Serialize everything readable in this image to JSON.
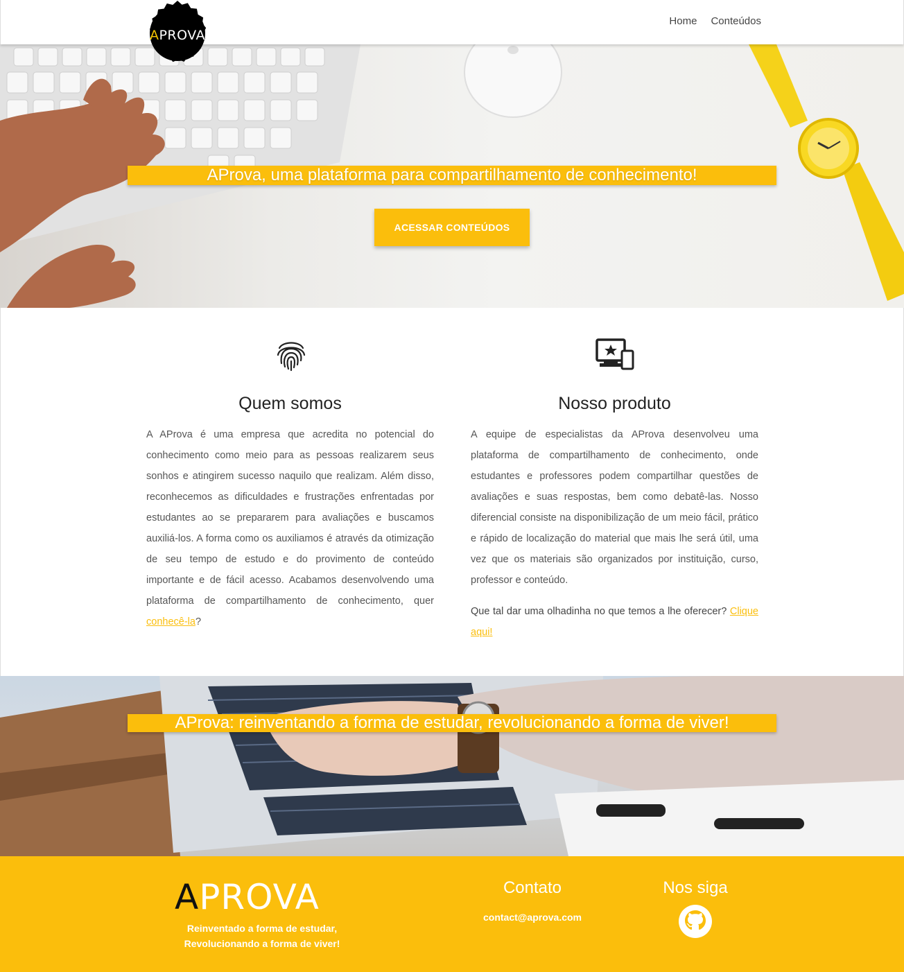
{
  "nav": {
    "logo": {
      "letter": "A",
      "rest": "PROVA"
    },
    "links": [
      "Home",
      "Conteúdos"
    ]
  },
  "hero": {
    "headline": "AProva, uma plataforma para compartilhamento de conhecimento!",
    "cta": "ACESSAR CONTEÚDOS"
  },
  "about": {
    "left": {
      "icon": "fingerprint-icon",
      "title": "Quem somos",
      "text": "A AProva é uma empresa que acredita no potencial do conhecimento como meio para as pessoas realizarem seus sonhos e atingirem sucesso naquilo que realizam. Além disso, reconhecemos as dificuldades e frustrações enfrentadas por estudantes ao se prepararem para avaliações e buscamos auxiliá-los. A forma como os auxiliamos é através da otimização de seu tempo de estudo e do provimento de conteúdo importante e de fácil acesso. Acabamos desenvolvendo uma plataforma de compartilhamento de conhecimento, quer ",
      "link": "conhecê-la",
      "end": "?"
    },
    "right": {
      "icon": "devices-star-icon",
      "title": "Nosso produto",
      "text": "A equipe de especialistas da AProva desenvolveu uma plataforma de compartilhamento de conhecimento, onde estudantes e professores podem compartilhar questões de avaliações e suas respostas, bem como debatê-las. Nosso diferencial consiste na disponibilização de um meio fácil, prático e rápido de localização do material que mais lhe será útil, uma vez que os materiais são organizados por instituição, curso, professor e conteúdo.",
      "question": "Que tal dar uma olhadinha no que temos a lhe oferecer? ",
      "link": "Clique aqui!"
    }
  },
  "hero2": {
    "headline": "AProva: reinventando a forma de estudar, revolucionando a forma de viver!"
  },
  "footer": {
    "logo": {
      "letter": "A",
      "rest": "PROVA"
    },
    "tagline1": "Reinventado a forma de estudar,",
    "tagline2": "Revolucionando a forma de viver!",
    "contact_title": "Contato",
    "contact_email": "contact@aprova.com",
    "follow_title": "Nos siga",
    "follow_icon": "github-icon"
  },
  "colors": {
    "accent": "#fbbe0c"
  }
}
